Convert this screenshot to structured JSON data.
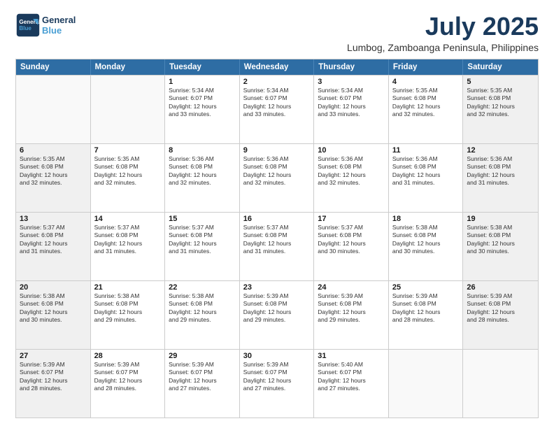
{
  "header": {
    "logo_line1": "General",
    "logo_line2": "Blue",
    "main_title": "July 2025",
    "subtitle": "Lumbog, Zamboanga Peninsula, Philippines"
  },
  "calendar": {
    "days_of_week": [
      "Sunday",
      "Monday",
      "Tuesday",
      "Wednesday",
      "Thursday",
      "Friday",
      "Saturday"
    ],
    "weeks": [
      [
        {
          "day": "",
          "info": "",
          "empty": true
        },
        {
          "day": "",
          "info": "",
          "empty": true
        },
        {
          "day": "1",
          "info": "Sunrise: 5:34 AM\nSunset: 6:07 PM\nDaylight: 12 hours\nand 33 minutes.",
          "shaded": false
        },
        {
          "day": "2",
          "info": "Sunrise: 5:34 AM\nSunset: 6:07 PM\nDaylight: 12 hours\nand 33 minutes.",
          "shaded": false
        },
        {
          "day": "3",
          "info": "Sunrise: 5:34 AM\nSunset: 6:07 PM\nDaylight: 12 hours\nand 33 minutes.",
          "shaded": false
        },
        {
          "day": "4",
          "info": "Sunrise: 5:35 AM\nSunset: 6:08 PM\nDaylight: 12 hours\nand 32 minutes.",
          "shaded": false
        },
        {
          "day": "5",
          "info": "Sunrise: 5:35 AM\nSunset: 6:08 PM\nDaylight: 12 hours\nand 32 minutes.",
          "shaded": true
        }
      ],
      [
        {
          "day": "6",
          "info": "Sunrise: 5:35 AM\nSunset: 6:08 PM\nDaylight: 12 hours\nand 32 minutes.",
          "shaded": true
        },
        {
          "day": "7",
          "info": "Sunrise: 5:35 AM\nSunset: 6:08 PM\nDaylight: 12 hours\nand 32 minutes.",
          "shaded": false
        },
        {
          "day": "8",
          "info": "Sunrise: 5:36 AM\nSunset: 6:08 PM\nDaylight: 12 hours\nand 32 minutes.",
          "shaded": false
        },
        {
          "day": "9",
          "info": "Sunrise: 5:36 AM\nSunset: 6:08 PM\nDaylight: 12 hours\nand 32 minutes.",
          "shaded": false
        },
        {
          "day": "10",
          "info": "Sunrise: 5:36 AM\nSunset: 6:08 PM\nDaylight: 12 hours\nand 32 minutes.",
          "shaded": false
        },
        {
          "day": "11",
          "info": "Sunrise: 5:36 AM\nSunset: 6:08 PM\nDaylight: 12 hours\nand 31 minutes.",
          "shaded": false
        },
        {
          "day": "12",
          "info": "Sunrise: 5:36 AM\nSunset: 6:08 PM\nDaylight: 12 hours\nand 31 minutes.",
          "shaded": true
        }
      ],
      [
        {
          "day": "13",
          "info": "Sunrise: 5:37 AM\nSunset: 6:08 PM\nDaylight: 12 hours\nand 31 minutes.",
          "shaded": true
        },
        {
          "day": "14",
          "info": "Sunrise: 5:37 AM\nSunset: 6:08 PM\nDaylight: 12 hours\nand 31 minutes.",
          "shaded": false
        },
        {
          "day": "15",
          "info": "Sunrise: 5:37 AM\nSunset: 6:08 PM\nDaylight: 12 hours\nand 31 minutes.",
          "shaded": false
        },
        {
          "day": "16",
          "info": "Sunrise: 5:37 AM\nSunset: 6:08 PM\nDaylight: 12 hours\nand 31 minutes.",
          "shaded": false
        },
        {
          "day": "17",
          "info": "Sunrise: 5:37 AM\nSunset: 6:08 PM\nDaylight: 12 hours\nand 30 minutes.",
          "shaded": false
        },
        {
          "day": "18",
          "info": "Sunrise: 5:38 AM\nSunset: 6:08 PM\nDaylight: 12 hours\nand 30 minutes.",
          "shaded": false
        },
        {
          "day": "19",
          "info": "Sunrise: 5:38 AM\nSunset: 6:08 PM\nDaylight: 12 hours\nand 30 minutes.",
          "shaded": true
        }
      ],
      [
        {
          "day": "20",
          "info": "Sunrise: 5:38 AM\nSunset: 6:08 PM\nDaylight: 12 hours\nand 30 minutes.",
          "shaded": true
        },
        {
          "day": "21",
          "info": "Sunrise: 5:38 AM\nSunset: 6:08 PM\nDaylight: 12 hours\nand 29 minutes.",
          "shaded": false
        },
        {
          "day": "22",
          "info": "Sunrise: 5:38 AM\nSunset: 6:08 PM\nDaylight: 12 hours\nand 29 minutes.",
          "shaded": false
        },
        {
          "day": "23",
          "info": "Sunrise: 5:39 AM\nSunset: 6:08 PM\nDaylight: 12 hours\nand 29 minutes.",
          "shaded": false
        },
        {
          "day": "24",
          "info": "Sunrise: 5:39 AM\nSunset: 6:08 PM\nDaylight: 12 hours\nand 29 minutes.",
          "shaded": false
        },
        {
          "day": "25",
          "info": "Sunrise: 5:39 AM\nSunset: 6:08 PM\nDaylight: 12 hours\nand 28 minutes.",
          "shaded": false
        },
        {
          "day": "26",
          "info": "Sunrise: 5:39 AM\nSunset: 6:08 PM\nDaylight: 12 hours\nand 28 minutes.",
          "shaded": true
        }
      ],
      [
        {
          "day": "27",
          "info": "Sunrise: 5:39 AM\nSunset: 6:07 PM\nDaylight: 12 hours\nand 28 minutes.",
          "shaded": true
        },
        {
          "day": "28",
          "info": "Sunrise: 5:39 AM\nSunset: 6:07 PM\nDaylight: 12 hours\nand 28 minutes.",
          "shaded": false
        },
        {
          "day": "29",
          "info": "Sunrise: 5:39 AM\nSunset: 6:07 PM\nDaylight: 12 hours\nand 27 minutes.",
          "shaded": false
        },
        {
          "day": "30",
          "info": "Sunrise: 5:39 AM\nSunset: 6:07 PM\nDaylight: 12 hours\nand 27 minutes.",
          "shaded": false
        },
        {
          "day": "31",
          "info": "Sunrise: 5:40 AM\nSunset: 6:07 PM\nDaylight: 12 hours\nand 27 minutes.",
          "shaded": false
        },
        {
          "day": "",
          "info": "",
          "empty": true
        },
        {
          "day": "",
          "info": "",
          "empty": true
        }
      ]
    ]
  }
}
